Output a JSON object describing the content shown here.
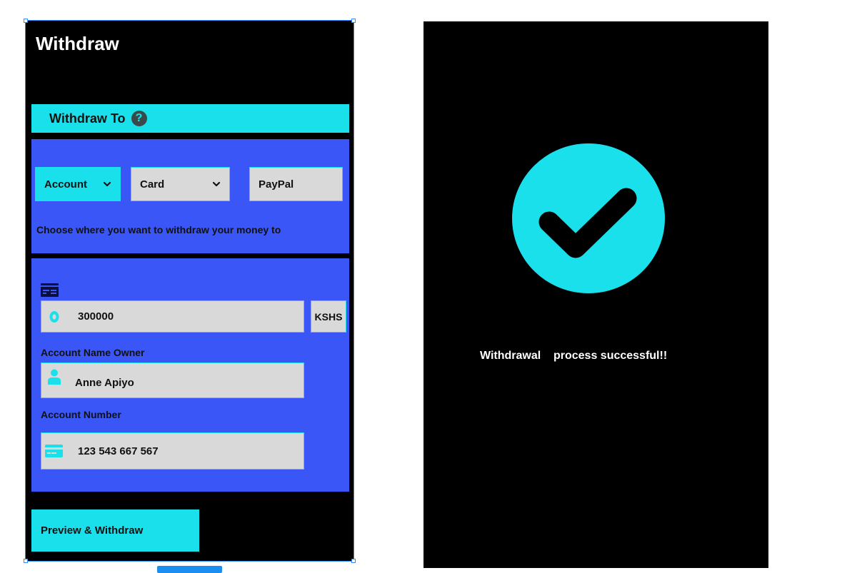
{
  "withdraw_screen": {
    "title": "Withdraw",
    "section_header": {
      "label": "Withdraw To",
      "help_icon": "question-circle-icon",
      "help_glyph": "?"
    },
    "methods": [
      {
        "label": "Account",
        "selected": true,
        "has_dropdown": true
      },
      {
        "label": "Card",
        "selected": false,
        "has_dropdown": true
      },
      {
        "label": "PayPal",
        "selected": false,
        "has_dropdown": false
      }
    ],
    "method_hint": "Choose where you want to withdraw your money to",
    "form": {
      "card_icon": "card-details-icon",
      "amount": {
        "value": "300000",
        "icon": "coin-icon"
      },
      "currency": "KSHS",
      "owner_label": "Account  Name Owner",
      "owner": {
        "value": "Anne Apiyo",
        "icon": "user-icon"
      },
      "number_label": "Account Number",
      "number": {
        "value": "123 543 667 567",
        "icon": "credit-card-icon"
      }
    },
    "primary_action": "Preview & Withdraw"
  },
  "success_screen": {
    "icon": "check-circle-icon",
    "message": "Withdrawal    process successful!!"
  },
  "colors": {
    "background": "#000000",
    "accent_cyan": "#19e0ea",
    "panel_blue": "#3a56f7",
    "field_gray": "#d9d9d9",
    "selection_blue": "#2f8cff"
  }
}
